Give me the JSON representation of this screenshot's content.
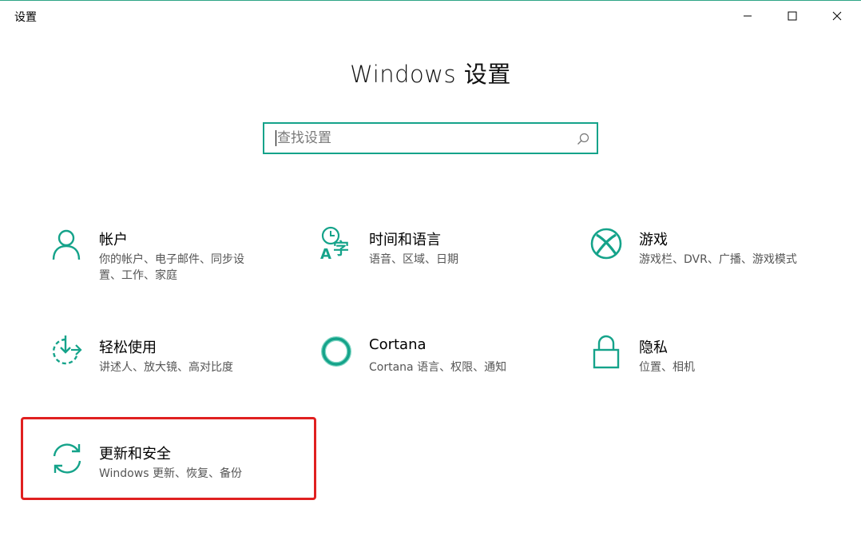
{
  "window": {
    "title": "设置",
    "accent_color": "#15a38a",
    "controls": {
      "minimize": "minimize-icon",
      "maximize": "maximize-icon",
      "close": "close-icon"
    }
  },
  "header": {
    "title": "Windows 设置"
  },
  "search": {
    "placeholder": "查找设置",
    "value": "",
    "icon": "search-icon"
  },
  "categories": [
    {
      "id": "accounts",
      "icon": "person-icon",
      "title": "帐户",
      "desc": "你的帐户、电子邮件、同步设置、工作、家庭"
    },
    {
      "id": "time-language",
      "icon": "time-language-icon",
      "title": "时间和语言",
      "desc": "语音、区域、日期"
    },
    {
      "id": "gaming",
      "icon": "xbox-icon",
      "title": "游戏",
      "desc": "游戏栏、DVR、广播、游戏模式"
    },
    {
      "id": "ease-of-access",
      "icon": "ease-of-access-icon",
      "title": "轻松使用",
      "desc": "讲述人、放大镜、高对比度"
    },
    {
      "id": "cortana",
      "icon": "cortana-icon",
      "title": "Cortana",
      "desc": "Cortana 语言、权限、通知"
    },
    {
      "id": "privacy",
      "icon": "lock-icon",
      "title": "隐私",
      "desc": "位置、相机"
    },
    {
      "id": "update-security",
      "icon": "sync-icon",
      "title": "更新和安全",
      "desc": "Windows 更新、恢复、备份"
    }
  ],
  "annotation": {
    "highlight_color": "#e02020",
    "highlighted_item": "update-security"
  }
}
